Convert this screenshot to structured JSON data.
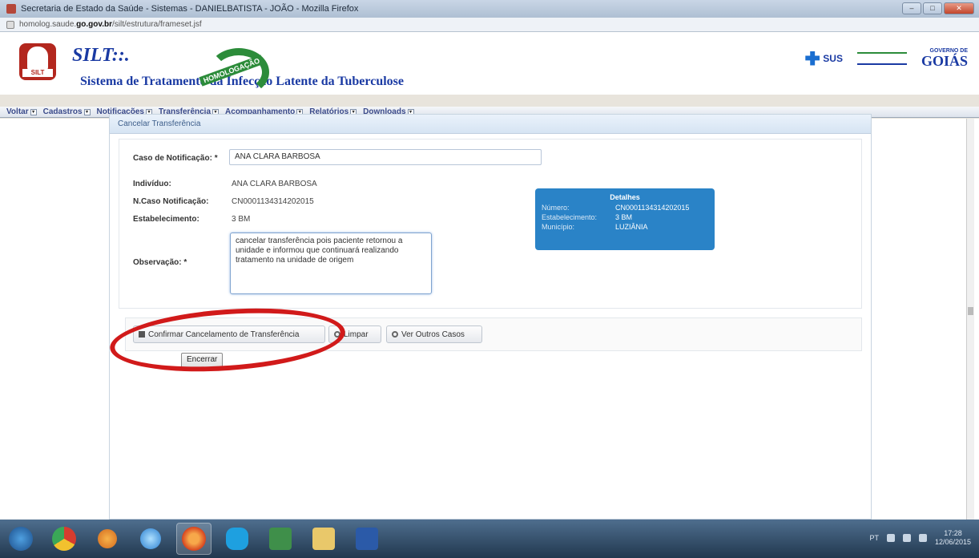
{
  "window": {
    "title": "Secretaria de Estado da Saúde - Sistemas - DANIELBATISTA - JOÃO - Mozilla Firefox",
    "url_prefix": "homolog.saude.",
    "url_domain": "go.gov.br",
    "url_path": "/silt/estrutura/frameset.jsf"
  },
  "header": {
    "brand": "SILT::.",
    "subtitle": "Sistema de Tratamento da Infecção Latente da Tuberculose",
    "logo_tag": "SILT",
    "homolog_label": "HOMOLOGAÇÃO",
    "sus_label": "SUS",
    "gov_line1": "GOVERNO DE",
    "gov_line2": "GOIÁS"
  },
  "menu": {
    "items": [
      {
        "label": "Voltar"
      },
      {
        "label": "Cadastros"
      },
      {
        "label": "Notificações"
      },
      {
        "label": "Transferência"
      },
      {
        "label": "Acompanhamento"
      },
      {
        "label": "Relatórios"
      },
      {
        "label": "Downloads"
      }
    ]
  },
  "panel": {
    "title": "Cancelar Transferência"
  },
  "form": {
    "caso_label": "Caso de Notificação: *",
    "caso_value": "ANA CLARA BARBOSA",
    "individuo_label": "Indivíduo:",
    "individuo_value": "ANA CLARA BARBOSA",
    "ncaso_label": "N.Caso Notificação:",
    "ncaso_value": "CN0001134314202015",
    "estab_label": "Estabelecimento:",
    "estab_value": "3 BM",
    "obs_label": "Observação: *",
    "obs_value": "cancelar transferência pois paciente retornou a unidade e informou que continuará realizando tratamento na unidade de origem"
  },
  "detalhes": {
    "title": "Detalhes",
    "numero_label": "Número:",
    "numero_value": "CN0001134314202015",
    "estab_label": "Estabelecimento:",
    "estab_value": "3 BM",
    "municipio_label": "Município:",
    "municipio_value": "LUZIÂNIA"
  },
  "buttons": {
    "confirmar": "Confirmar Cancelamento de Transferência",
    "limpar": "Limpar",
    "ver_outros": "Ver Outros Casos",
    "encerrar": "Encerrar"
  },
  "tray": {
    "lang": "PT",
    "time": "17:28",
    "date": "12/06/2015"
  }
}
